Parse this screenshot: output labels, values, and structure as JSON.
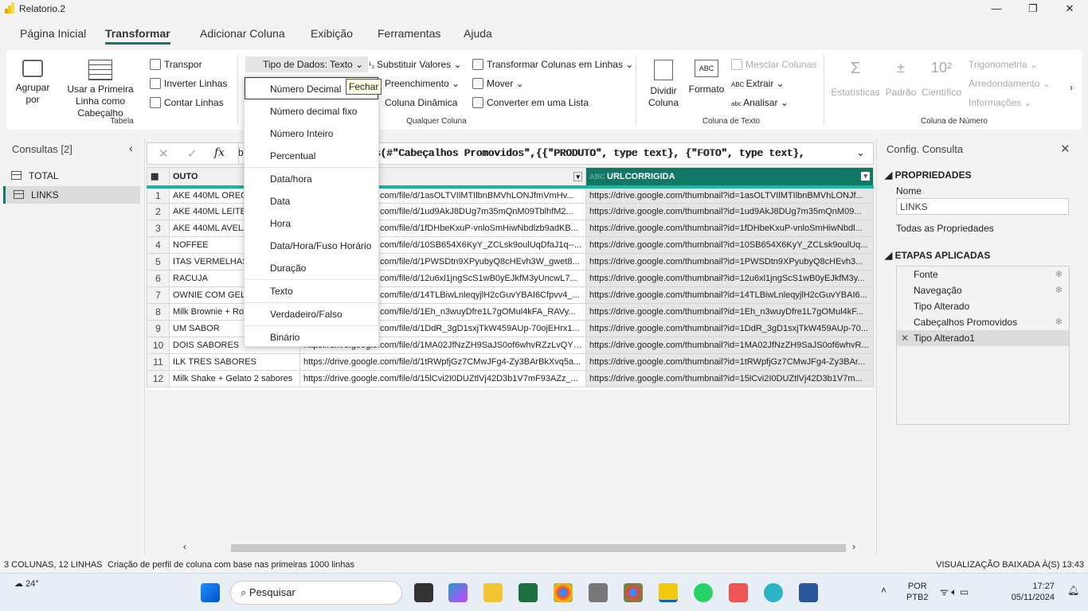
{
  "window": {
    "title": "Relatorio.2"
  },
  "tabs": [
    "Página Inicial",
    "Transformar",
    "Adicionar Coluna",
    "Exibição",
    "Ferramentas",
    "Ajuda"
  ],
  "ribbon": {
    "tabela": {
      "label": "Tabela",
      "agrupar": "Agrupar por",
      "usar_primeira_linha": "Usar a Primeira Linha como Cabeçalho",
      "transpor": "Transpor",
      "inverter": "Inverter Linhas",
      "contar": "Contar Linhas"
    },
    "qualquer": {
      "label": "Qualquer Coluna",
      "tipo_dados": "Tipo de Dados: Texto",
      "substituir": "Substituir Valores",
      "preenchimento": "Preenchimento",
      "coluna_dinamica": "Coluna Dinâmica",
      "transformar_colunas": "Transformar Colunas em Linhas",
      "mover": "Mover",
      "converter_lista": "Converter em uma Lista"
    },
    "texto": {
      "label": "Coluna de Texto",
      "dividir": "Dividir Coluna",
      "formato": "Formato",
      "mesclar": "Mesclar Colunas",
      "extrair": "Extrair",
      "analisar": "Analisar"
    },
    "numero": {
      "label": "Coluna de Número",
      "estatisticas": "Estatísticas",
      "padrao": "Padrão",
      "cientifico": "Científico",
      "trigonometria": "Trigonometria",
      "arredondamento": "Arredondamento",
      "informacoes": "Informações"
    }
  },
  "queries": {
    "title": "Consultas [2]",
    "items": [
      "TOTAL",
      "LINKS"
    ],
    "selected": "LINKS"
  },
  "formula": "= Table.TransformColumnTypes(#\"Cabeçalhos Promovidos\",{{\"PRODUTO\", type text}, {\"FOTO\", type text},",
  "formula_visible": "pes(#\"Cabeçalhos Promovidos\",{{\"PRODUTO\", type text}, {\"FOTO\", type text},",
  "grid": {
    "columns": [
      "OUTO",
      "",
      "URLCORRIGIDA"
    ],
    "rows": [
      [
        "1",
        "AKE 440ML OREO",
        "https://drive.google.com/file/d/1asOLTVIlMTIlbnBMVhLONJfmVmHv...",
        "https://drive.google.com/thumbnail?id=1asOLTVIlMTIlbnBMVhLONJf..."
      ],
      [
        "2",
        "AKE 440ML LEITE NI",
        "https://drive.google.com/file/d/1ud9AkJ8DUg7m35mQnM09TblhfM2...",
        "https://drive.google.com/thumbnail?id=1ud9AkJ8DUg7m35mQnM09..."
      ],
      [
        "3",
        "AKE 440ML AVELA E",
        "https://drive.google.com/file/d/1fDHbeKxuP-vnloSmHiwNbdlzb9adKB...",
        "https://drive.google.com/thumbnail?id=1fDHbeKxuP-vnloSmHiwNbdl..."
      ],
      [
        "4",
        "NOFFEE",
        "https://drive.google.com/file/d/10SB654X6KyY_ZCLsk9oulUqDfaJ1q--...",
        "https://drive.google.com/thumbnail?id=10SB654X6KyY_ZCLsk9oulUq..."
      ],
      [
        "5",
        "ITAS VERMELHAS",
        "https://drive.google.com/file/d/1PWSDtn9XPyubyQ8cHEvh3W_gwet8...",
        "https://drive.google.com/thumbnail?id=1PWSDtn9XPyubyQ8cHEvh3..."
      ],
      [
        "6",
        "RACUJA",
        "https://drive.google.com/file/d/12u6xl1jngScS1wB0yEJkfM3yUncwL7...",
        "https://drive.google.com/thumbnail?id=12u6xl1jngScS1wB0yEJkfM3y..."
      ],
      [
        "7",
        "OWNIE COM GELAT",
        "https://drive.google.com/file/d/14TLBiwLnleqyjlH2cGuvYBAI6Cfpvv4_...",
        "https://drive.google.com/thumbnail?id=14TLBiwLnleqyjlH2cGuvYBAI6..."
      ],
      [
        "8",
        "Milk Brownie + Roll",
        "https://drive.google.com/file/d/1Eh_n3wuyDfre1L7gOMul4kFA_RAVy...",
        "https://drive.google.com/thumbnail?id=1Eh_n3wuyDfre1L7gOMul4kF..."
      ],
      [
        "9",
        "UM SABOR",
        "https://drive.google.com/file/d/1DdR_3gD1sxjTkW459AUp-70ojEHrx1...",
        "https://drive.google.com/thumbnail?id=1DdR_3gD1sxjTkW459AUp-70..."
      ],
      [
        "10",
        "DOIS SABORES",
        "https://drive.google.com/file/d/1MA02JfNzZH9SaJS0of6whvRZzLvQYT...",
        "https://drive.google.com/thumbnail?id=1MA02JfNzZH9SaJS0of6whvR..."
      ],
      [
        "11",
        "ILK TRES SABORES",
        "https://drive.google.com/file/d/1tRWpfjGz7CMwJFg4-Zy3BArBkXvq5a...",
        "https://drive.google.com/thumbnail?id=1tRWpfjGz7CMwJFg4-Zy3BAr..."
      ],
      [
        "12",
        "Milk Shake + Gelato 2 sabores",
        "https://drive.google.com/file/d/15lCvi2I0DUZtlVj42D3b1V7mF93AZz_...",
        "https://drive.google.com/thumbnail?id=15lCvi2I0DUZtlVj42D3b1V7m..."
      ]
    ]
  },
  "type_menu": {
    "items": [
      "Número Decimal",
      "Número decimal fixo",
      "Número Inteiro",
      "Percentual",
      "Data/hora",
      "Data",
      "Hora",
      "Data/Hora/Fuso Horário",
      "Duração",
      "Texto",
      "Verdadeiro/Falso",
      "Binário"
    ],
    "tooltip": "Fechar"
  },
  "settings": {
    "title": "Config. Consulta",
    "propriedades": "PROPRIEDADES",
    "nome_label": "Nome",
    "nome_value": "LINKS",
    "todas": "Todas as Propriedades",
    "etapas": "ETAPAS APLICADAS",
    "steps": [
      "Fonte",
      "Navegação",
      "Tipo Alterado",
      "Cabeçalhos Promovidos",
      "Tipo Alterado1"
    ]
  },
  "status": {
    "left": "3 COLUNAS, 12 LINHAS",
    "profile": "Criação de perfil de coluna com base nas primeiras 1000 linhas",
    "right": "VISUALIZAÇÃO BAIXADA À(S) 13:43"
  },
  "taskbar": {
    "temp": "24°",
    "search": "Pesquisar",
    "lang1": "POR",
    "lang2": "PTB2",
    "time": "17:27",
    "date": "05/11/2024"
  },
  "colors": {
    "accent": "#117865",
    "header_underline": "#1bb5a2"
  }
}
